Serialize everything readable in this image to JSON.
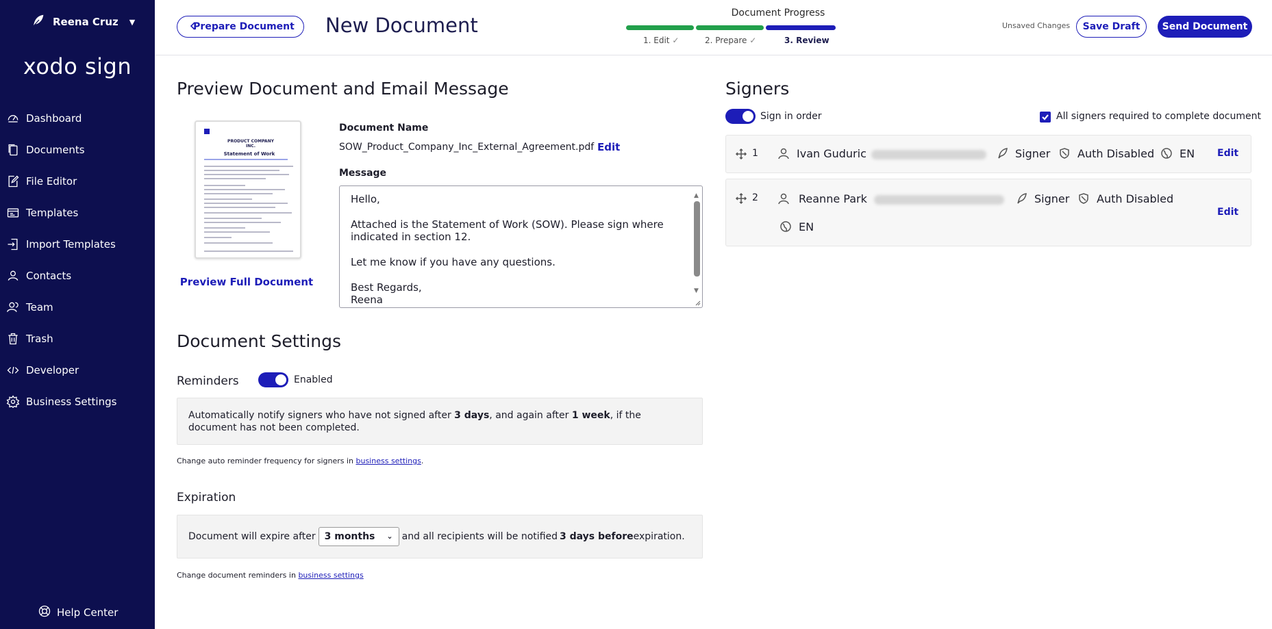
{
  "sidebar": {
    "user_name": "Reena Cruz",
    "brand": "xodo sign",
    "items": [
      {
        "label": "Dashboard",
        "icon": "dashboard-icon"
      },
      {
        "label": "Documents",
        "icon": "documents-icon"
      },
      {
        "label": "File Editor",
        "icon": "file-editor-icon"
      },
      {
        "label": "Templates",
        "icon": "templates-icon"
      },
      {
        "label": "Import Templates",
        "icon": "import-templates-icon"
      },
      {
        "label": "Contacts",
        "icon": "contacts-icon"
      },
      {
        "label": "Team",
        "icon": "team-icon"
      },
      {
        "label": "Trash",
        "icon": "trash-icon"
      },
      {
        "label": "Developer",
        "icon": "developer-icon"
      },
      {
        "label": "Business Settings",
        "icon": "gear-icon"
      }
    ],
    "help": "Help Center"
  },
  "header": {
    "back_label": "Prepare Document",
    "title": "New Document",
    "progress_title": "Document Progress",
    "steps": [
      {
        "label": "1. Edit",
        "done": true,
        "color": "#22a04b"
      },
      {
        "label": "2. Prepare",
        "done": true,
        "color": "#22a04b"
      },
      {
        "label": "3. Review",
        "done": false,
        "color": "#1d1db8"
      }
    ],
    "unsaved": "Unsaved Changes",
    "save_label": "Save Draft",
    "send_label": "Send Document"
  },
  "preview": {
    "heading": "Preview Document and Email Message",
    "preview_link": "Preview Full Document",
    "thumb_company": "PRODUCT COMPANY INC.",
    "thumb_title": "Statement of Work",
    "doc_name_label": "Document Name",
    "doc_name": "SOW_Product_Company_Inc_External_Agreement.pdf",
    "edit_label": "Edit",
    "message_label": "Message",
    "message_lines": [
      "Hello,",
      "Attached is the Statement of Work (SOW). Please sign where indicated in section 12.",
      "Let me know if you have any questions.",
      "Best Regards,",
      "Reena"
    ]
  },
  "settings": {
    "heading": "Document Settings",
    "reminders_label": "Reminders",
    "reminders_state": "Enabled",
    "reminders_text_1": "Automatically notify signers who have not signed after ",
    "reminders_bold_1": "3 days",
    "reminders_text_2": ", and again after ",
    "reminders_bold_2": "1 week",
    "reminders_text_3": ", if the document has not been completed.",
    "reminders_note": "Change auto reminder frequency for signers in ",
    "reminders_note_link": "business settings",
    "reminders_note_end": ".",
    "expiration_label": "Expiration",
    "expire_text_1": "Document will expire after",
    "expire_value": "3 months",
    "expire_text_2": "and all recipients will be notified ",
    "expire_bold": "3 days before",
    "expire_text_3": " expiration.",
    "expire_note": "Change document reminders in ",
    "expire_note_link": "business settings"
  },
  "signers": {
    "heading": "Signers",
    "sign_in_order": "Sign in order",
    "all_required": "All signers required to complete document",
    "list": [
      {
        "order": "1",
        "name": "Ivan Guduric",
        "role": "Signer",
        "auth": "Auth Disabled",
        "lang": "EN",
        "edit": "Edit"
      },
      {
        "order": "2",
        "name": "Reanne Park",
        "role": "Signer",
        "auth": "Auth Disabled",
        "lang": "EN",
        "edit": "Edit"
      }
    ]
  }
}
